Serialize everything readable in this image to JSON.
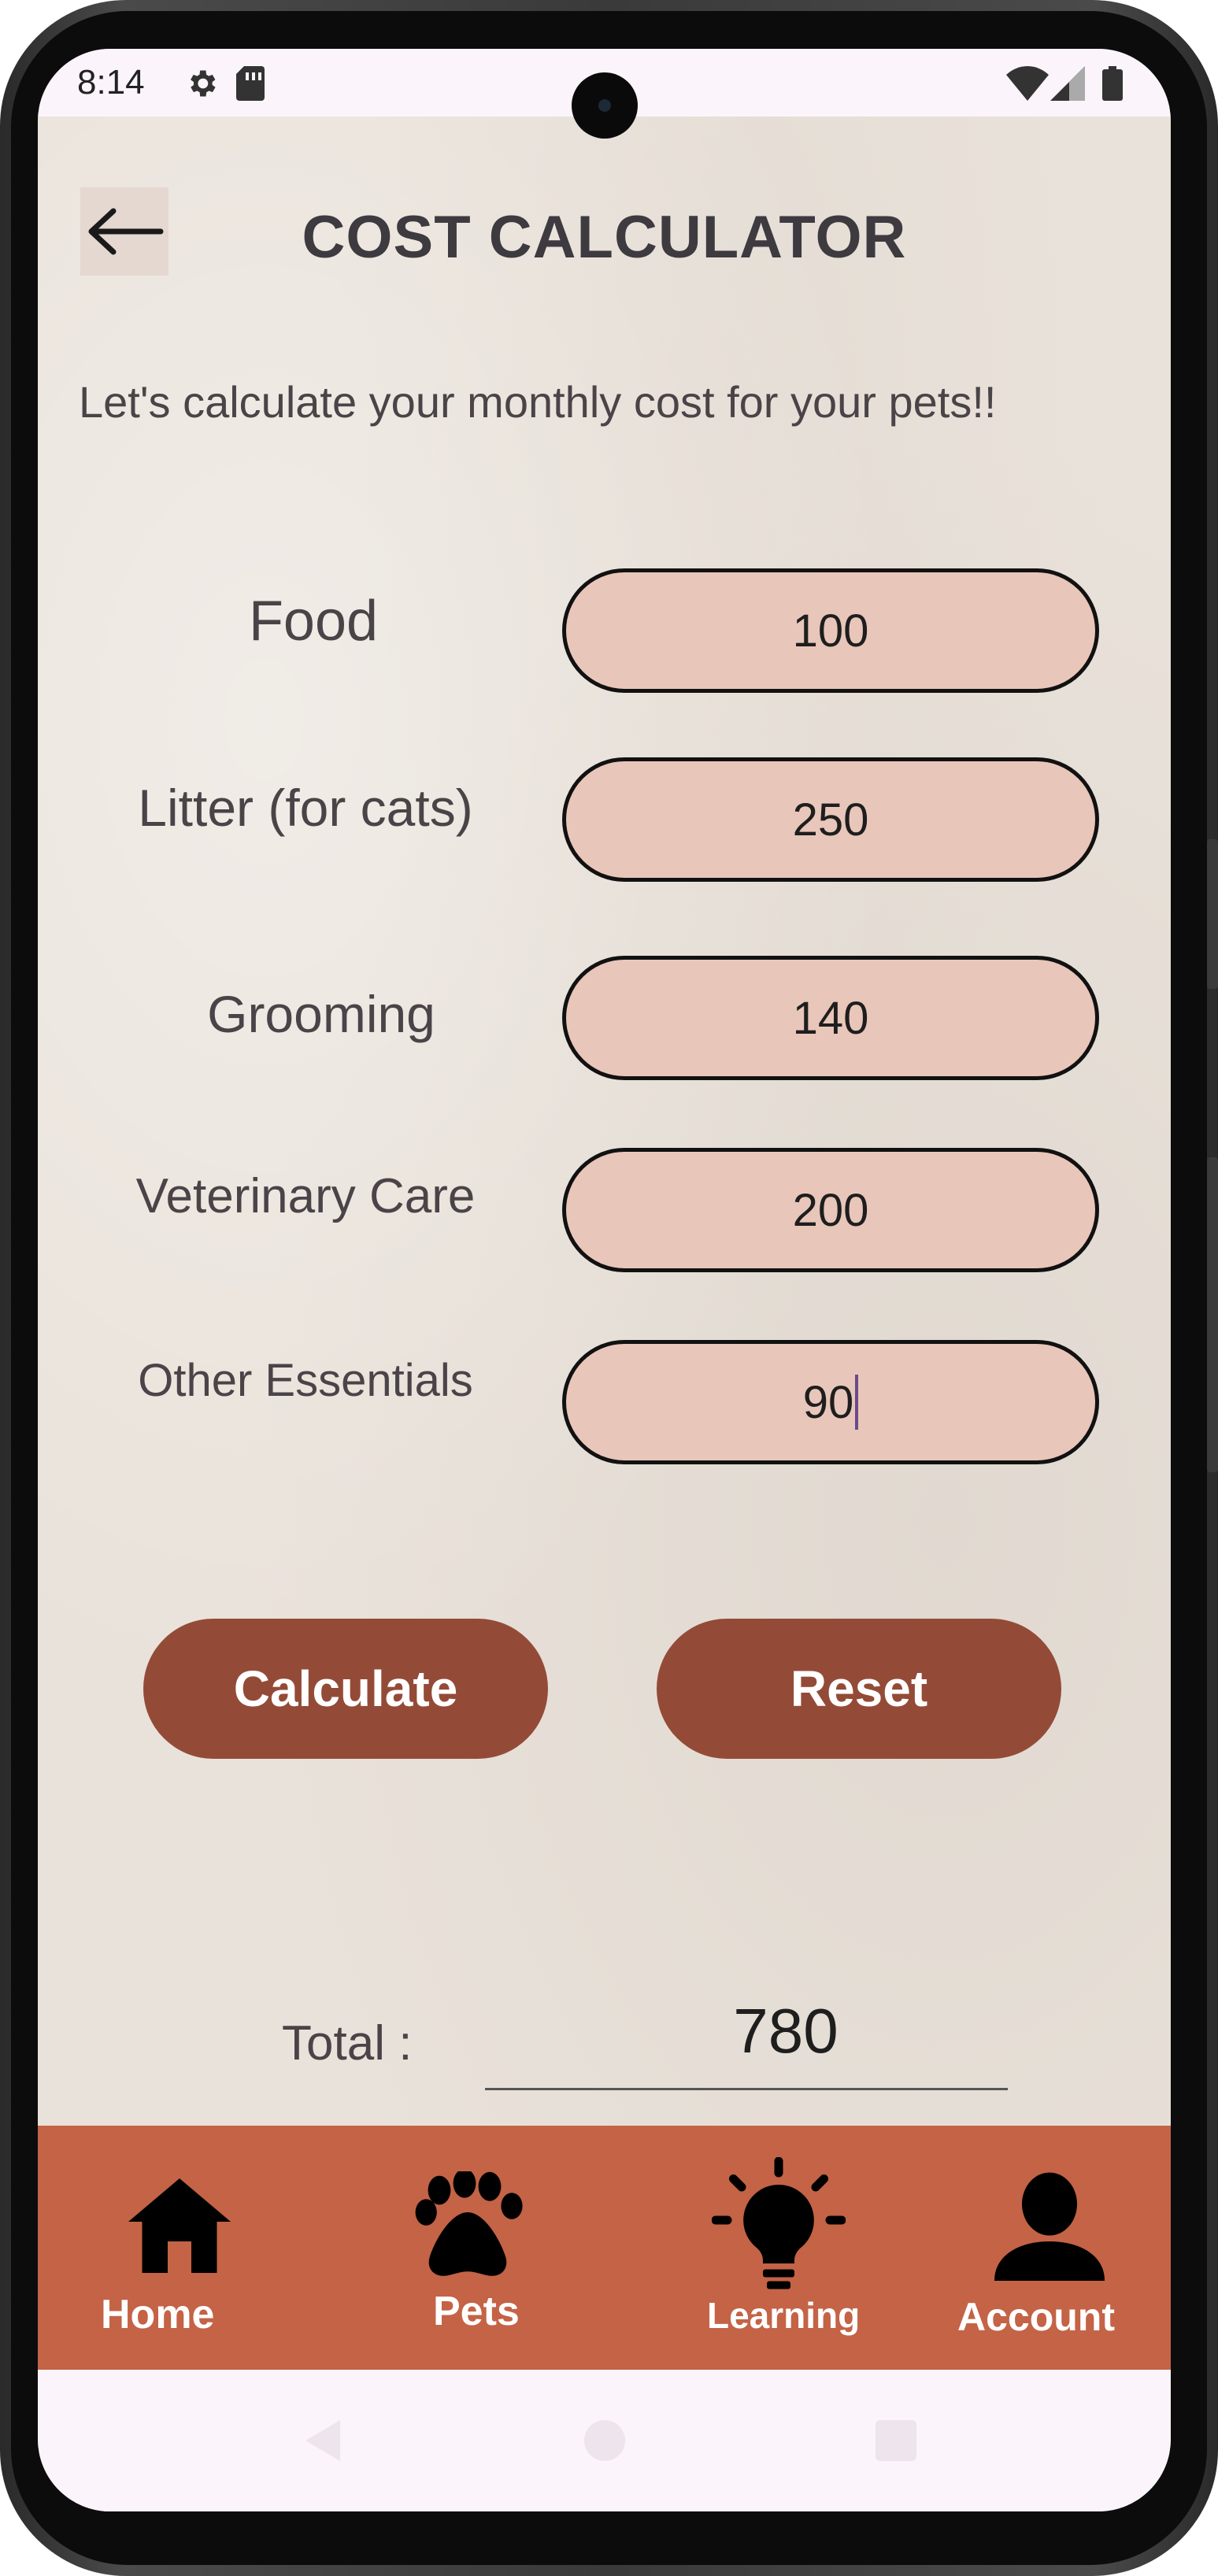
{
  "status_bar": {
    "time": "8:14",
    "icons": [
      "settings-icon",
      "sim-card-icon",
      "wifi-icon",
      "cellular-signal-icon",
      "battery-icon"
    ]
  },
  "header": {
    "back_icon": "arrow-left-icon",
    "title": "COST CALCULATOR"
  },
  "subtitle": "Let's calculate your monthly cost for your pets!!",
  "expenses": [
    {
      "label": "Food",
      "value": "100"
    },
    {
      "label": "Litter (for cats)",
      "value": "250"
    },
    {
      "label": "Grooming",
      "value": "140"
    },
    {
      "label": "Veterinary Care",
      "value": "200"
    },
    {
      "label": "Other Essentials",
      "value": "90"
    }
  ],
  "actions": {
    "calculate_label": "Calculate",
    "reset_label": "Reset"
  },
  "total": {
    "label": "Total  :",
    "value": "780"
  },
  "bottom_nav": [
    {
      "label": "Home",
      "icon": "home-icon"
    },
    {
      "label": "Pets",
      "icon": "paw-icon"
    },
    {
      "label": "Learning",
      "icon": "lightbulb-icon"
    },
    {
      "label": "Account",
      "icon": "user-icon"
    }
  ],
  "system_nav": [
    "back-triangle-icon",
    "home-circle-icon",
    "recents-square-icon"
  ],
  "colors": {
    "field_fill": "#e9c6ba",
    "button_fill": "#934b38",
    "nav_bar": "#c46346",
    "background": "#e9e2da"
  }
}
